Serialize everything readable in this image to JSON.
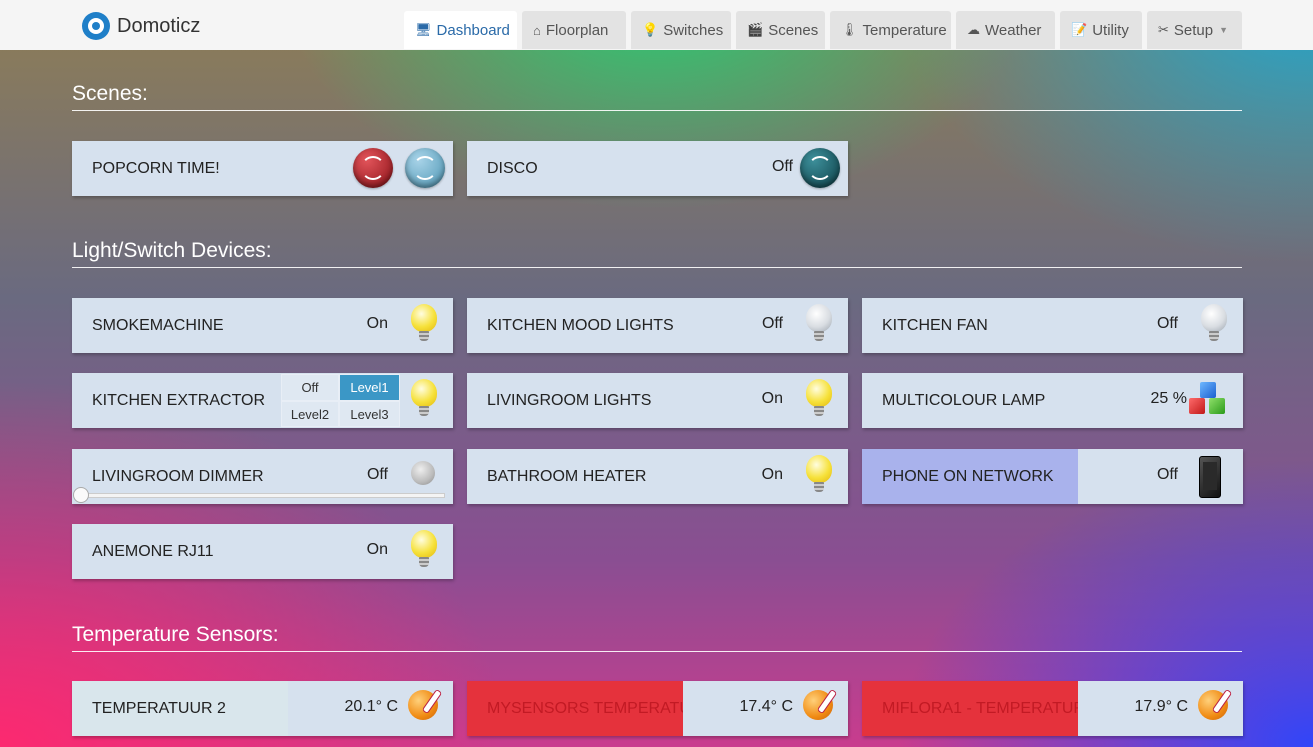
{
  "brand": {
    "name": "Domoticz"
  },
  "nav": {
    "tabs": [
      {
        "label": "Dashboard",
        "icon": "monitor-icon"
      },
      {
        "label": "Floorplan",
        "icon": "floorplan-icon"
      },
      {
        "label": "Switches",
        "icon": "lightbulb-icon"
      },
      {
        "label": "Scenes",
        "icon": "clapperboard-icon"
      },
      {
        "label": "Temperature",
        "icon": "thermometer-icon"
      },
      {
        "label": "Weather",
        "icon": "cloud-icon"
      },
      {
        "label": "Utility",
        "icon": "notepad-icon"
      },
      {
        "label": "Setup",
        "icon": "tools-icon"
      }
    ],
    "active": "Dashboard"
  },
  "scenes": {
    "title": "Scenes:",
    "items": [
      {
        "name": "POPCORN TIME!",
        "status": ""
      },
      {
        "name": "DISCO",
        "status": "Off"
      }
    ]
  },
  "lights": {
    "title": "Light/Switch Devices:",
    "items": [
      {
        "name": "SMOKEMACHINE",
        "status": "On"
      },
      {
        "name": "KITCHEN MOOD LIGHTS",
        "status": "Off"
      },
      {
        "name": "KITCHEN FAN",
        "status": "Off"
      },
      {
        "name": "KITCHEN EXTRACTOR",
        "status": "",
        "levels": [
          "Off",
          "Level1",
          "Level2",
          "Level3"
        ],
        "active_level": "Level1"
      },
      {
        "name": "LIVINGROOM LIGHTS",
        "status": "On"
      },
      {
        "name": "MULTICOLOUR LAMP",
        "status": "25 %"
      },
      {
        "name": "LIVINGROOM DIMMER",
        "status": "Off",
        "slider_level": 0
      },
      {
        "name": "BATHROOM HEATER",
        "status": "On"
      },
      {
        "name": "PHONE ON NETWORK",
        "status": "Off"
      },
      {
        "name": "ANEMONE RJ11",
        "status": "On"
      }
    ]
  },
  "temperature": {
    "title": "Temperature Sensors:",
    "items": [
      {
        "name": "TEMPERATUUR 2",
        "value": "20.1° C"
      },
      {
        "name": "MYSENSORS TEMPERATU",
        "value": "17.4° C"
      },
      {
        "name": "MIFLORA1 - TEMPERATUR",
        "value": "17.9° C"
      }
    ]
  },
  "colors": {
    "card_bg": "#d6e1ee",
    "active_tab_text": "#2a6aa8",
    "selector_active": "#3b97c6",
    "phone_name_panel": "#a9b2ec",
    "temp_alert_red": "#e5323c"
  }
}
